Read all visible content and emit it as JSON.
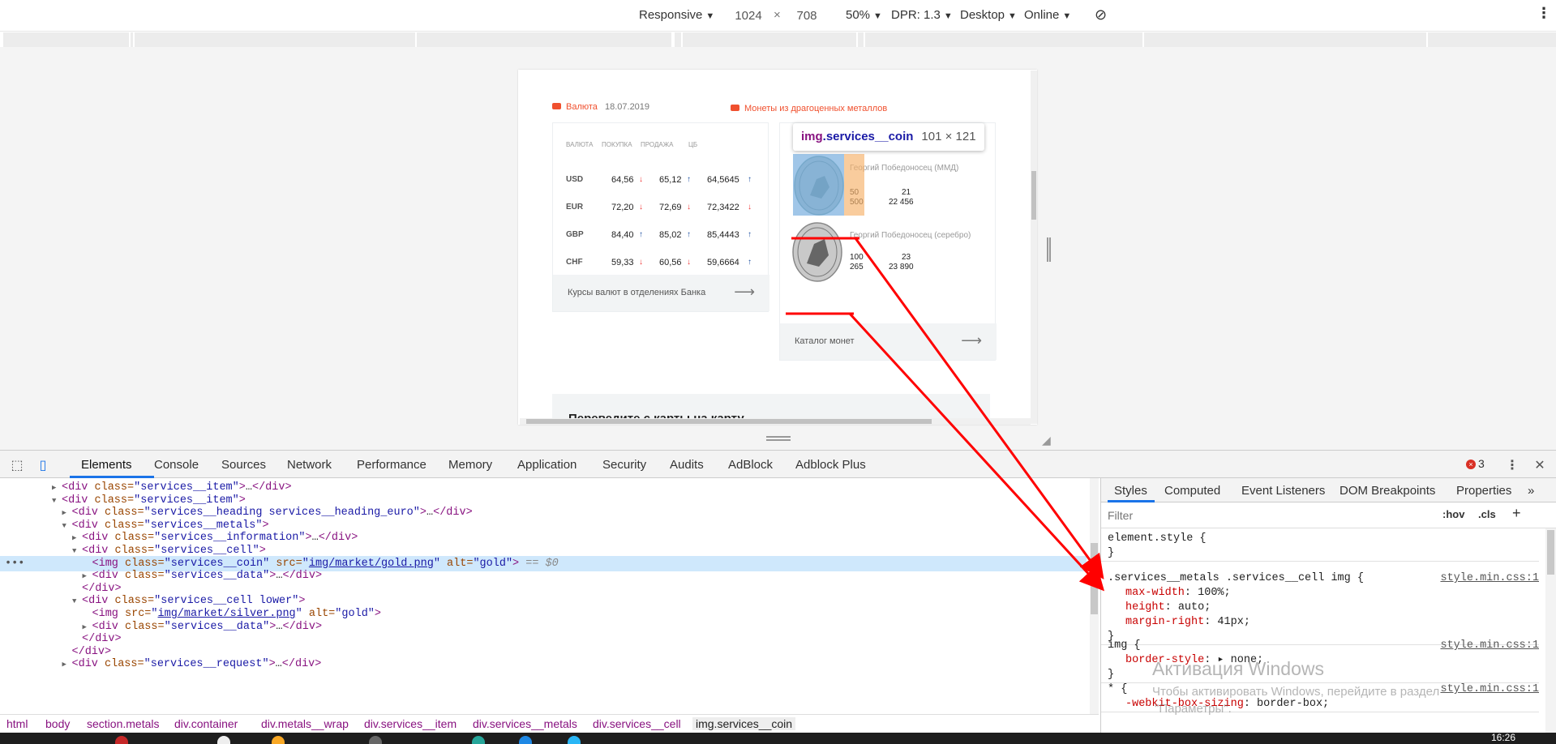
{
  "device_toolbar": {
    "device": "Responsive",
    "width": "1024",
    "times": "×",
    "height": "708",
    "zoom": "50%",
    "dpr": "DPR: 1.3",
    "mode": "Desktop",
    "network": "Online"
  },
  "page": {
    "currency": {
      "title": "Валюта",
      "date": "18.07.2019",
      "headers": [
        "ВАЛЮТА",
        "ПОКУПКА",
        "ПРОДАЖА",
        "ЦБ"
      ],
      "rows": [
        {
          "code": "USD",
          "buy": "64,56",
          "buy_dir": "↓",
          "sell": "65,12",
          "sell_dir": "↑",
          "cb": "64,5645",
          "cb_dir": "↑"
        },
        {
          "code": "EUR",
          "buy": "72,20",
          "buy_dir": "↓",
          "sell": "72,69",
          "sell_dir": "↓",
          "cb": "72,3422",
          "cb_dir": "↓"
        },
        {
          "code": "GBP",
          "buy": "84,40",
          "buy_dir": "↑",
          "sell": "85,02",
          "sell_dir": "↑",
          "cb": "85,4443",
          "cb_dir": "↑"
        },
        {
          "code": "CHF",
          "buy": "59,33",
          "buy_dir": "↓",
          "sell": "60,56",
          "sell_dir": "↓",
          "cb": "59,6664",
          "cb_dir": "↑"
        }
      ],
      "footer": "Курсы валют в отделениях Банка",
      "footer_arrow": "⟶"
    },
    "coins": {
      "title": "Монеты из драгоценных металлов",
      "items": [
        {
          "name": "Георгий Победоносец (ММД)",
          "v1": "50",
          "v2": "21",
          "v3": "500",
          "v4": "22 456"
        },
        {
          "name": "Георгий Победоносец (серебро)",
          "v1": "100",
          "v2": "23",
          "v3": "265",
          "v4": "23 890"
        }
      ],
      "footer": "Каталог монет",
      "footer_arrow": "⟶"
    },
    "promo": "Переведите с карты на карту",
    "inspect_tooltip": {
      "tag": "img",
      "cls": ".services__coin",
      "size": "101 × 121"
    }
  },
  "devtools": {
    "tabs": [
      "Elements",
      "Console",
      "Sources",
      "Network",
      "Performance",
      "Memory",
      "Application",
      "Security",
      "Audits",
      "AdBlock",
      "Adblock Plus"
    ],
    "error_count": "3",
    "dom_lines": [
      {
        "indent": 4,
        "tri": "▶",
        "html": "<div class=\"services__item\">…</div>"
      },
      {
        "indent": 4,
        "tri": "▼",
        "html": "<div class=\"services__item\">"
      },
      {
        "indent": 5,
        "tri": "▶",
        "html": "<div class=\"services__heading services__heading_euro\">…</div>"
      },
      {
        "indent": 5,
        "tri": "▼",
        "html": "<div class=\"services__metals\">"
      },
      {
        "indent": 6,
        "tri": "▶",
        "html": "<div class=\"services__information\">…</div>"
      },
      {
        "indent": 6,
        "tri": "▼",
        "html": "<div class=\"services__cell\">"
      },
      {
        "indent": 7,
        "tri": "",
        "html": "<img class=\"services__coin\" src=\"img/market/gold.png\" alt=\"gold\">",
        "suffix": " == $0",
        "selected": true
      },
      {
        "indent": 7,
        "tri": "▶",
        "html": "<div class=\"services__data\">…</div>"
      },
      {
        "indent": 6,
        "tri": "",
        "html": "</div>"
      },
      {
        "indent": 6,
        "tri": "▼",
        "html": "<div class=\"services__cell lower\">"
      },
      {
        "indent": 7,
        "tri": "",
        "html": "<img src=\"img/market/silver.png\" alt=\"gold\">"
      },
      {
        "indent": 7,
        "tri": "▶",
        "html": "<div class=\"services__data\">…</div>"
      },
      {
        "indent": 6,
        "tri": "",
        "html": "</div>"
      },
      {
        "indent": 5,
        "tri": "",
        "html": "</div>"
      },
      {
        "indent": 5,
        "tri": "▶",
        "html": "<div class=\"services__request\">…</div>"
      }
    ],
    "breadcrumbs": [
      "html",
      "body",
      "section.metals",
      "div.container",
      "div.metals__wrap",
      "div.services__item",
      "div.services__metals",
      "div.services__cell",
      "img.services__coin"
    ],
    "styles_tabs": [
      "Styles",
      "Computed",
      "Event Listeners",
      "DOM Breakpoints",
      "Properties"
    ],
    "more_tabs": "»",
    "filter_placeholder": "Filter",
    "filter_hov": ":hov",
    "filter_cls": ".cls",
    "filter_plus": "+",
    "rules": [
      {
        "selector": "element.style {",
        "source": "",
        "props": [],
        "close": "}"
      },
      {
        "selector": ".services__metals .services__cell img {",
        "source": "style.min.css:1",
        "props": [
          {
            "name": "max-width",
            "value": "100%;"
          },
          {
            "name": "height",
            "value": "auto;"
          },
          {
            "name": "margin-right",
            "value": "41px;"
          }
        ],
        "close": "}"
      },
      {
        "selector": "img {",
        "source": "style.min.css:1",
        "props": [
          {
            "name": "border-style",
            "value": "▸ none;"
          }
        ],
        "close": "}"
      },
      {
        "selector": "* {",
        "source": "style.min.css:1",
        "props": [
          {
            "name": "-webkit-box-sizing",
            "value": "border-box;"
          }
        ],
        "close": ""
      }
    ],
    "watermark_title": "Активация Windows",
    "watermark_text": "Чтобы активировать Windows, перейдите в раздел",
    "watermark_text2": "\"Параметры\"."
  },
  "taskbar": {
    "clock": "16:26"
  },
  "colors": {
    "accent": "#f0502e",
    "devtools_blue": "#1a73e8",
    "arrow_annotation": "#ff0000"
  }
}
